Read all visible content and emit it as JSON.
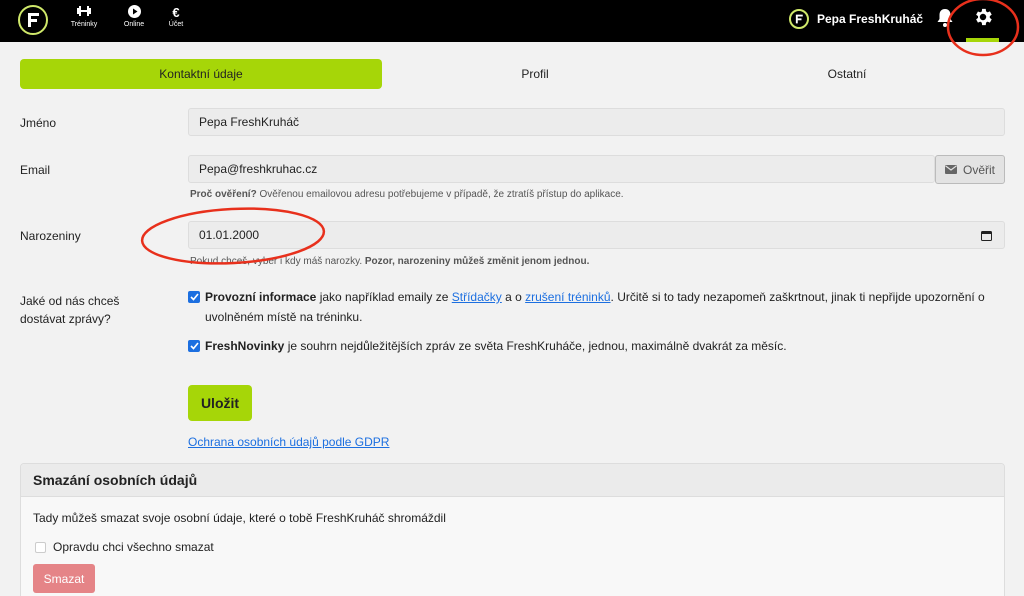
{
  "nav": {
    "items": [
      {
        "label": "Tréninky",
        "icon": "dumbbell-icon"
      },
      {
        "label": "Online",
        "icon": "play-icon"
      },
      {
        "label": "Účet",
        "icon": "euro-icon"
      }
    ],
    "user_name": "Pepa FreshKruháč"
  },
  "tabs": {
    "contact": "Kontaktní údaje",
    "profile": "Profil",
    "other": "Ostatní"
  },
  "form": {
    "name_label": "Jméno",
    "name_value": "Pepa FreshKruháč",
    "email_label": "Email",
    "email_value": "Pepa@freshkruhac.cz",
    "verify_label": "Ověřit",
    "email_help_bold": "Proč ověření?",
    "email_help": " Ověřenou emailovou adresu potřebujeme v případě, že ztratíš přístup do aplikace.",
    "birthday_label": "Narozeniny",
    "birthday_value": "01.01.2000",
    "birthday_help": "Pokud chceš, vyber i kdy máš narozky. ",
    "birthday_help_bold": "Pozor, narozeniny můžeš změnit jenom jednou.",
    "messages_label": "Jaké od nás chceš dostávat zprávy?",
    "opt1_bold": "Provozní informace",
    "opt1_a": " jako například emaily ze ",
    "opt1_link1": "Střídačky",
    "opt1_b": " a o ",
    "opt1_link2": "zrušení tréninků",
    "opt1_c": ". Určitě si to tady nezapomeň zaškrtnout, jinak ti nepřijde upozornění o uvolněném místě na tréninku.",
    "opt2_bold": "FreshNovinky",
    "opt2_text": " je souhrn nejdůležitějších zpráv ze světa FreshKruháče, jednou, maximálně dvakrát za měsíc.",
    "save_label": "Uložit",
    "gdpr_link": "Ochrana osobních údajů podle GDPR"
  },
  "delete_card": {
    "title": "Smazání osobních údajů",
    "text": "Tady můžeš smazat svoje osobní údaje, které o tobě FreshKruháč shromáždil",
    "confirm_label": "Opravdu chci všechno smazat",
    "delete_label": "Smazat"
  },
  "colors": {
    "accent": "#a6d608",
    "link": "#1c6fe0",
    "danger": "#e58487",
    "annotation": "#e8301c"
  }
}
